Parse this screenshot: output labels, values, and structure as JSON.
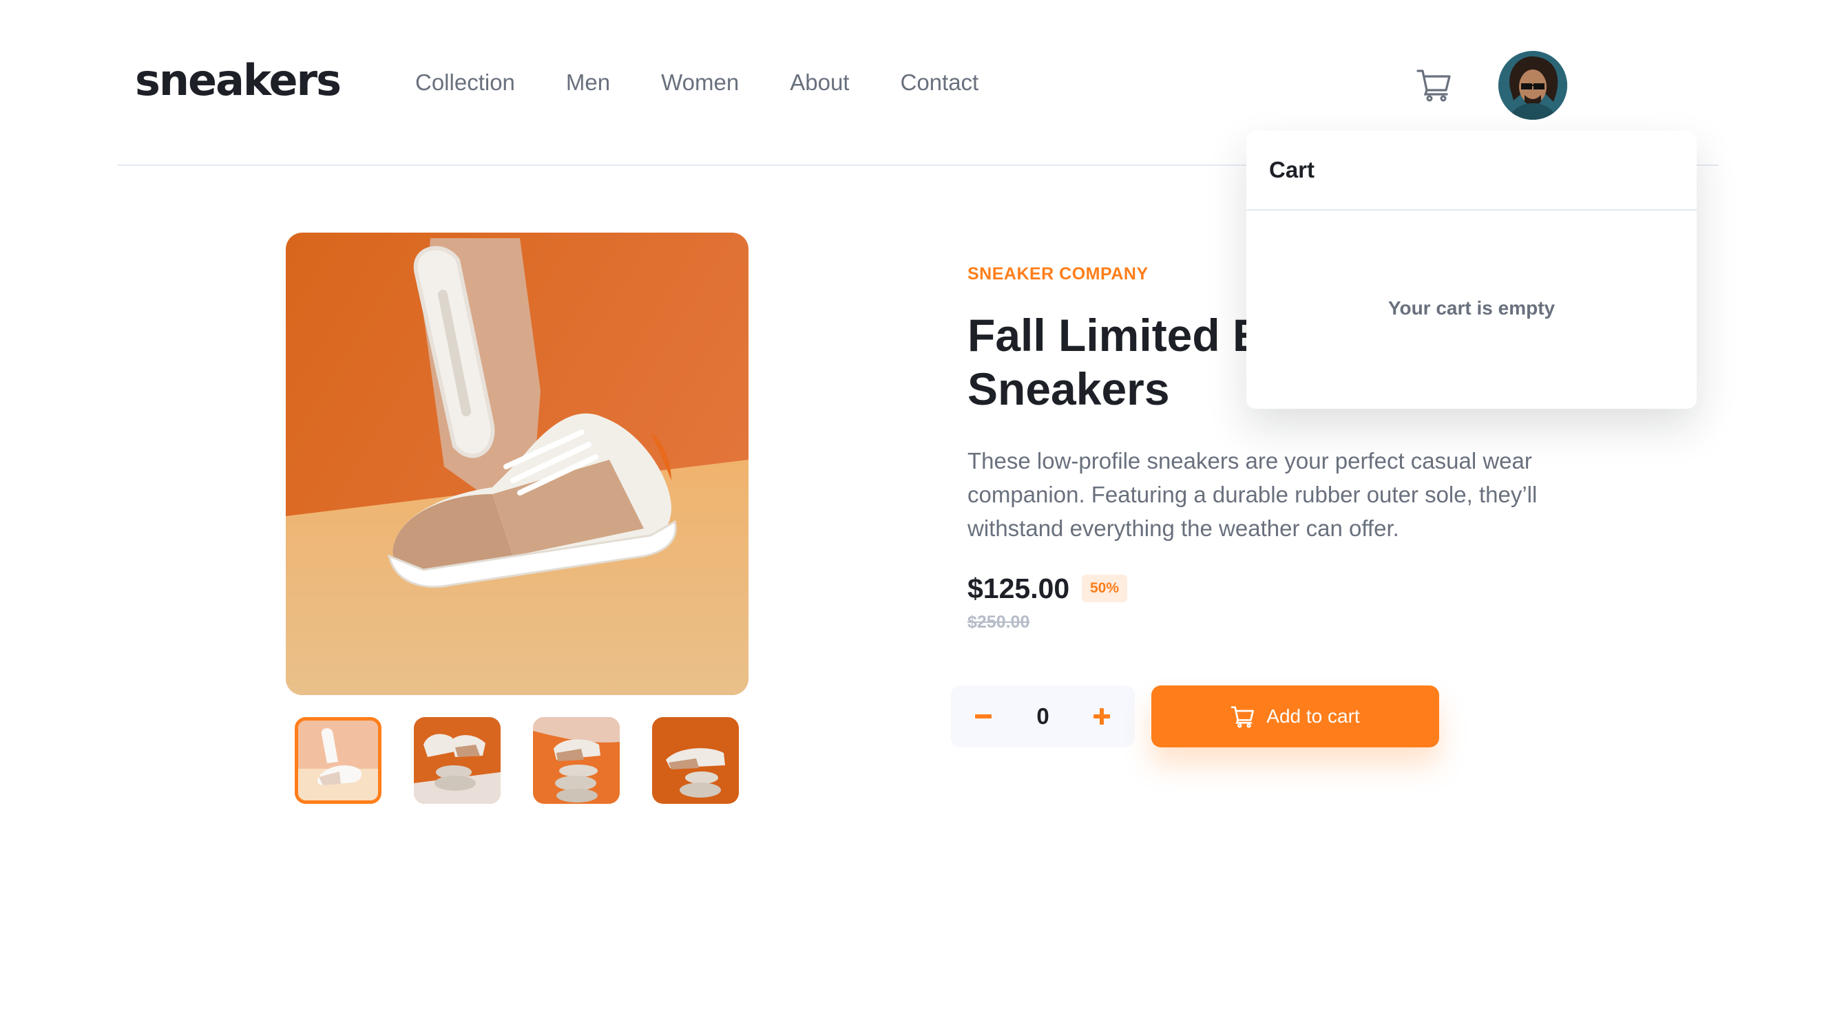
{
  "header": {
    "logo": "sneakers",
    "nav": [
      "Collection",
      "Men",
      "Women",
      "About",
      "Contact"
    ],
    "cart_icon": "cart-icon",
    "avatar_icon": "user-avatar"
  },
  "gallery": {
    "thumbnail_count": 4,
    "active_thumbnail": 1
  },
  "product": {
    "brand": "SNEAKER COMPANY",
    "title": "Fall Limited Edition Sneakers",
    "description": "These low-profile sneakers are your perfect casual wear companion. Featuring a durable rubber outer sole, they’ll withstand everything the weather can offer.",
    "price": "$125.00",
    "discount": "50%",
    "old_price": "$250.00"
  },
  "quantity": {
    "value": "0",
    "minus_icon": "minus-icon",
    "plus_icon": "plus-icon"
  },
  "add_to_cart": {
    "label": "Add to cart"
  },
  "cart_panel": {
    "title": "Cart",
    "empty_message": "Your cart is empty"
  },
  "colors": {
    "accent": "#ff7e1b",
    "accent_light": "#ffede0",
    "text_dark": "#1d2026",
    "text_muted": "#69707d",
    "text_faint": "#b6bcc8",
    "divider": "#e4e9f2"
  }
}
